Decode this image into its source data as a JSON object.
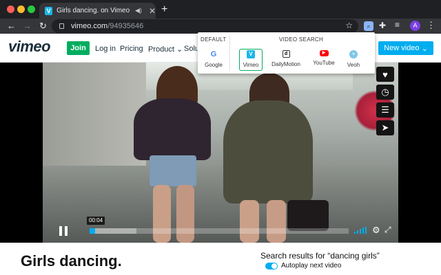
{
  "browser": {
    "tab": {
      "title": "Girls dancing. on Vimeo",
      "favicon": "vimeo-favicon",
      "audio_icon": "speaker-icon"
    },
    "url": {
      "host": "vimeo.com",
      "path": "/94935646"
    },
    "avatar_letter": "A"
  },
  "vimeo": {
    "logo": "vimeo",
    "join": "Join",
    "nav": {
      "login": "Log in",
      "pricing": "Pricing",
      "product": "Product",
      "solutions": "Solu"
    },
    "new_video": "New video"
  },
  "popup": {
    "default_heading": "DEFAULT",
    "search_heading": "VIDEO SEARCH",
    "engines": {
      "google": {
        "label": "Google",
        "glyph": "G"
      },
      "vimeo": {
        "label": "Vimeo",
        "glyph": "V"
      },
      "dailymotion": {
        "label": "DailyMotion",
        "glyph": "d"
      },
      "youtube": {
        "label": "YouTube",
        "glyph": "▶"
      },
      "veoh": {
        "label": "Veoh",
        "glyph": "v"
      }
    },
    "selected": "vimeo"
  },
  "player": {
    "time": "00:04",
    "progress": 0.02,
    "buffered": 0.18,
    "accent": "#00adef"
  },
  "page": {
    "title": "Girls dancing.",
    "results": "Search results for “dancing girls”",
    "autoplay": "Autoplay next video"
  }
}
